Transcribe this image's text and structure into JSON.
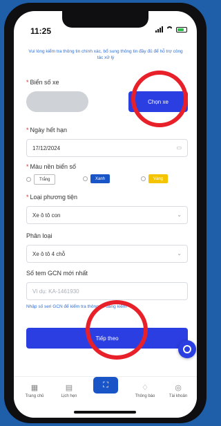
{
  "status": {
    "time": "11:25"
  },
  "notice": "Vui lòng kiểm tra thông tin chính xác, bổ sung thông tin đầy đủ để hỗ trợ công tác xử lý",
  "plate": {
    "label": "Biển số xe",
    "button": "Chọn xe"
  },
  "expiry": {
    "label": "Ngày hết hạn",
    "value": "17/12/2024"
  },
  "plate_color": {
    "label": "Màu nền biển số",
    "options": [
      "Trắng",
      "Xanh",
      "Vàng"
    ]
  },
  "vehicle_type": {
    "label": "Loại phương tiện",
    "value": "Xe ô tô con"
  },
  "category": {
    "label": "Phân loại",
    "value": "Xe ô tô 4 chỗ"
  },
  "gcn": {
    "label": "Số tem GCN mới nhất",
    "placeholder": "Vì dụ: KA-1461930"
  },
  "link": "Nhập số seri GCN để kiểm tra thông tin đăng kiểm",
  "next_button": "Tiếp theo",
  "tabs": [
    {
      "label": "Trang chủ",
      "icon": "grid-icon"
    },
    {
      "label": "Lịch hẹn",
      "icon": "calendar-icon"
    },
    {
      "label": "",
      "icon": "scan-icon"
    },
    {
      "label": "Thông báo",
      "icon": "bell-icon"
    },
    {
      "label": "Tài khoản",
      "icon": "user-icon"
    }
  ],
  "colors": {
    "primary": "#2b3ee2",
    "annotation": "#e8202a",
    "background": "#1f5ea8"
  }
}
